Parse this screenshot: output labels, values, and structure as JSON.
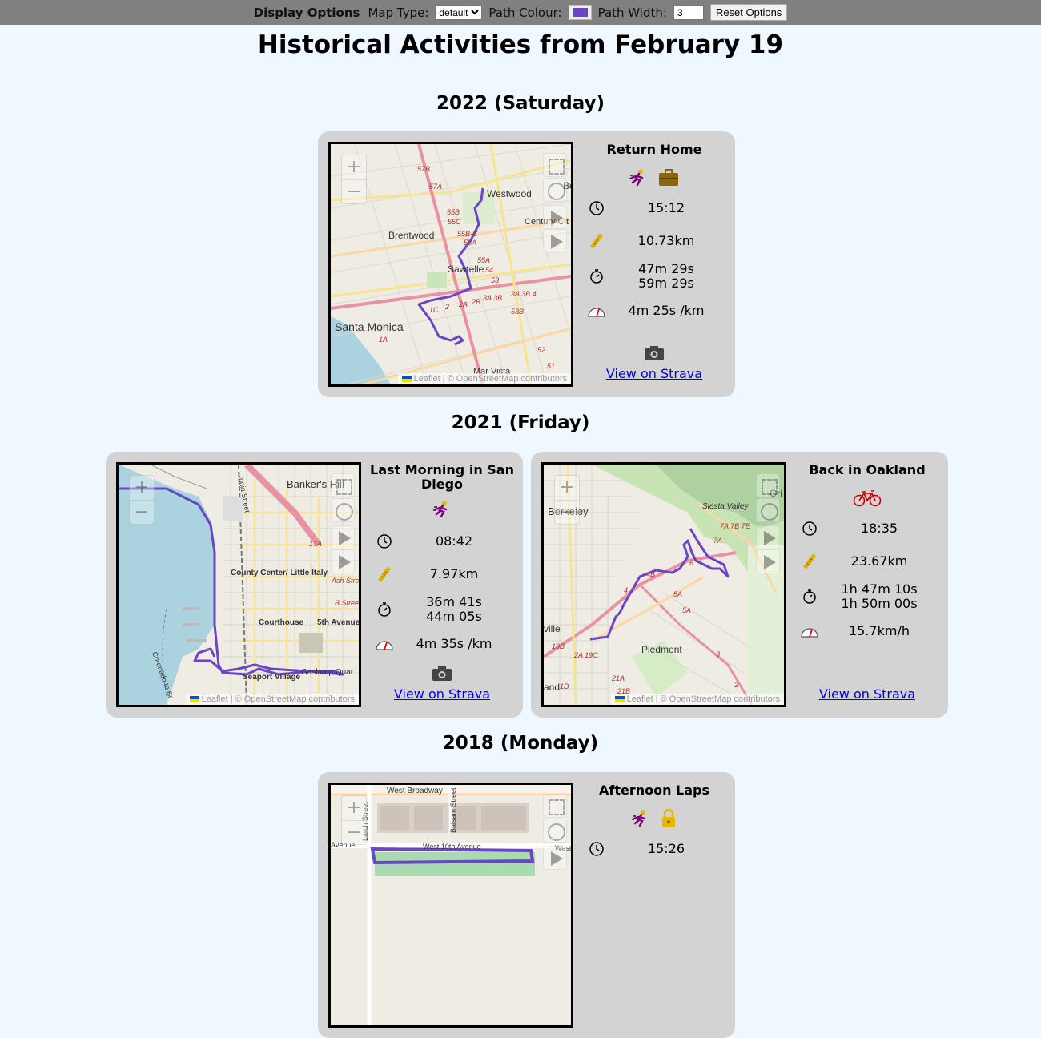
{
  "toolbar": {
    "heading": "Display Options",
    "map_type_label": "Map Type:",
    "map_type_value": "default",
    "path_colour_label": "Path Colour:",
    "path_colour": "#6a45c6",
    "path_width_label": "Path Width:",
    "path_width_value": "3",
    "reset_label": "Reset Options"
  },
  "page_title": "Historical Activities from February 19",
  "attribution": {
    "leaflet": "Leaflet",
    "sep": "| ©",
    "osm": "OpenStreetMap",
    "tail": "contributors"
  },
  "years": [
    {
      "heading": "2022 (Saturday)",
      "activities": [
        {
          "title": "Return Home",
          "icons": [
            "run-icon",
            "briefcase-icon"
          ],
          "time": "15:12",
          "distance": "10.73km",
          "moving_time": "47m 29s",
          "elapsed_time": "59m 29s",
          "pace": "4m 25s /km",
          "has_photos": true,
          "link": "View on Strava",
          "map_labels": [
            "Westwood",
            "Century Cit",
            "Brentwood",
            "Sawtelle",
            "Santa Monica",
            "Mar Vista",
            "Be"
          ]
        }
      ]
    },
    {
      "heading": "2021 (Friday)",
      "activities": [
        {
          "title": "Last Morning in San Diego",
          "icons": [
            "run-icon"
          ],
          "time": "08:42",
          "distance": "7.97km",
          "moving_time": "36m 41s",
          "elapsed_time": "44m 05s",
          "pace": "4m 35s /km",
          "has_photos": true,
          "link": "View on Strava",
          "map_labels": [
            "Banker's Hill",
            "County Center/ Little Italy",
            "Courthouse",
            "5th Avenue",
            "Seaport Village",
            "Gaslamp Quar",
            "India Street",
            "Coronado to Br"
          ]
        },
        {
          "title": "Back in Oakland",
          "icons": [
            "bike-icon"
          ],
          "time": "18:35",
          "distance": "23.67km",
          "moving_time": "1h 47m 10s",
          "elapsed_time": "1h 50m 00s",
          "pace": "15.7km/h",
          "has_photos": false,
          "link": "View on Strava",
          "map_labels": [
            "Berkeley",
            "Siesta Valley",
            "Piedmont",
            "ville",
            "and",
            "Ori"
          ]
        }
      ]
    },
    {
      "heading": "2018 (Monday)",
      "activities": [
        {
          "title": "Afternoon Laps",
          "icons": [
            "run-icon",
            "lock-icon"
          ],
          "time": "15:26",
          "map_labels": [
            "West Broadway",
            "Larch Street",
            "Balsam Street",
            "West 10th Avenue",
            "Avenue",
            "West"
          ]
        }
      ]
    }
  ]
}
